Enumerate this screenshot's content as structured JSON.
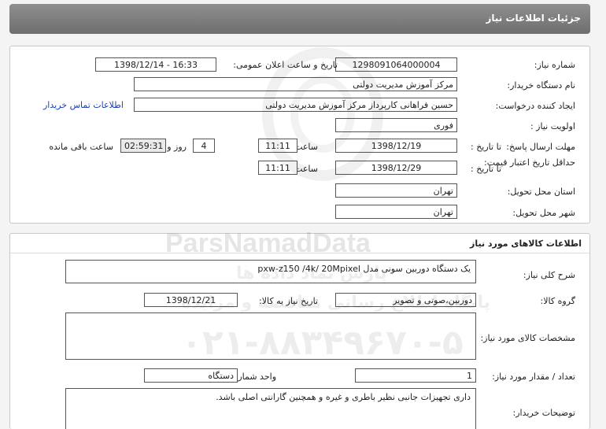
{
  "header": {
    "title": "جزئیات اطلاعات نیاز"
  },
  "need": {
    "number_label": "شماره نیاز:",
    "number": "1298091064000004",
    "announce_label": "تاریخ و ساعت اعلان عمومی:",
    "announce": "1398/12/14 - 16:33",
    "buyer_org_label": "نام دستگاه خریدار:",
    "buyer_org": "مرکز آموزش مدیریت دولتی",
    "creator_label": "ایجاد کننده درخواست:",
    "creator": "حسین  فراهانی کارپرداز مرکز آموزش مدیریت دولتی",
    "contact_link": "اطلاعات تماس خریدار",
    "priority_label": "اولویت نیاز :",
    "priority": "فوری",
    "reply_deadline_label": "مهلت ارسال پاسخ:",
    "to_date_label": "تا تاریخ :",
    "reply_date": "1398/12/19",
    "time_label": "ساعت",
    "reply_time": "11:11",
    "days": "4",
    "days_label": "روز و",
    "remaining_time": "02:59:31",
    "remaining_label": "ساعت باقی مانده",
    "validity_label": "حداقل تاریخ اعتبار قیمت:",
    "validity_date": "1398/12/29",
    "validity_time": "11:11",
    "province_label": "استان محل تحویل:",
    "province": "تهران",
    "city_label": "شهر محل تحویل:",
    "city": "تهران"
  },
  "goods": {
    "section_title": "اطلاعات کالاهای مورد نیاز",
    "summary_label": "شرح کلی نیاز:",
    "summary": "یک دستگاه دوربین سونی مدل pxw-z150 /4k/ 20Mpixel",
    "group_label": "گروه کالا:",
    "group": "دوربین،صوتی و تصویر",
    "need_date_label": "تاریخ نیاز به کالا:",
    "need_date": "1398/12/21",
    "specs_label": "مشخصات کالای مورد نیاز:",
    "specs": "",
    "qty_label": "تعداد / مقدار مورد نیاز:",
    "qty": "1",
    "unit_label": "واحد شمارش:",
    "unit": "دستگاه",
    "buyer_notes_label": "توضیحات خریدار:",
    "buyer_notes": "داری تجهیزات جانبی نظیر باطری و غیره و همچنین گارانتی اصلی باشد."
  },
  "watermark": {
    "brand": "ParsNamadData",
    "line1": "پارس نماد داده ها",
    "line2": "پایگاه اطلاع رسانی مناقصه و مزایده",
    "phone": "۰۲۱-۸۸۳۴۹۶۷۰-۵"
  }
}
